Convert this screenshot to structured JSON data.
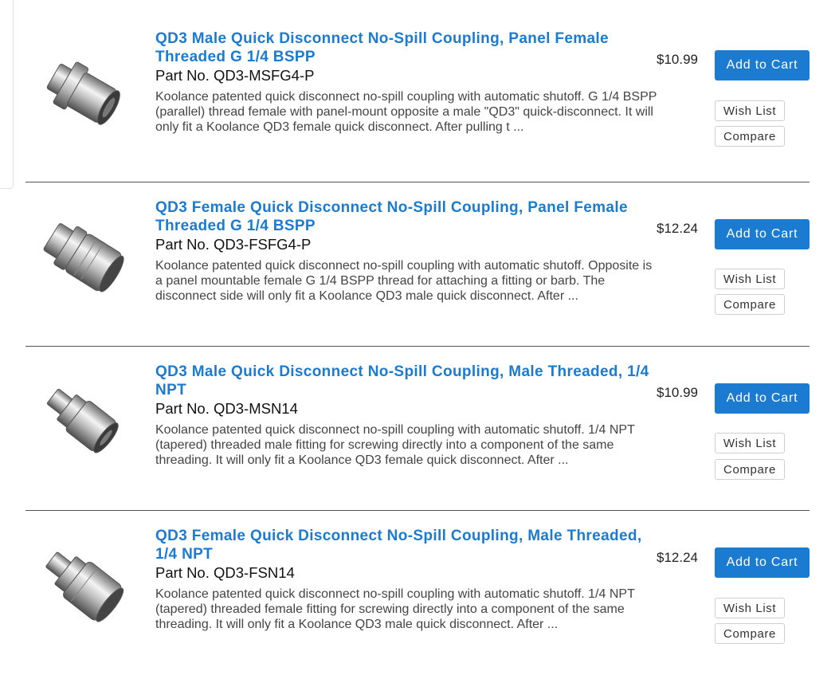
{
  "products": [
    {
      "title": "QD3 Male Quick Disconnect No-Spill Coupling, Panel Female Threaded G 1/4 BSPP",
      "part_no": "Part No. QD3-MSFG4-P",
      "description": "Koolance patented quick disconnect no-spill coupling with automatic shutoff. G 1/4 BSPP (parallel) thread female with panel-mount opposite a male \"QD3\" quick-disconnect. It will only fit a Koolance QD3 female quick disconnect. After pulling t ...",
      "price": "$10.99",
      "cart_label": "Add to Cart",
      "wish_label": "Wish List",
      "compare_label": "Compare"
    },
    {
      "title": "QD3 Female Quick Disconnect No-Spill Coupling, Panel Female Threaded G 1/4 BSPP",
      "part_no": "Part No. QD3-FSFG4-P",
      "description": "Koolance patented quick disconnect no-spill coupling with automatic shutoff. Opposite is a panel mountable female G 1/4 BSPP thread for attaching a fitting or barb. The disconnect side will only fit a Koolance QD3 male quick disconnect. After ...",
      "price": "$12.24",
      "cart_label": "Add to Cart",
      "wish_label": "Wish List",
      "compare_label": "Compare"
    },
    {
      "title": "QD3 Male Quick Disconnect No-Spill Coupling, Male Threaded, 1/4 NPT",
      "part_no": "Part No. QD3-MSN14",
      "description": "Koolance patented quick disconnect no-spill coupling with automatic shutoff. 1/4 NPT (tapered) threaded male fitting for screwing directly into a component of the same threading. It will only fit a Koolance QD3 female quick disconnect. After ...",
      "price": "$10.99",
      "cart_label": "Add to Cart",
      "wish_label": "Wish List",
      "compare_label": "Compare"
    },
    {
      "title": "QD3 Female Quick Disconnect No-Spill Coupling, Male Threaded, 1/4 NPT",
      "part_no": "Part No. QD3-FSN14",
      "description": "Koolance patented quick disconnect no-spill coupling with automatic shutoff. 1/4 NPT (tapered) threaded female fitting for screwing directly into a component of the same threading. It will only fit a Koolance QD3 male quick disconnect. After ...",
      "price": "$12.24",
      "cart_label": "Add to Cart",
      "wish_label": "Wish List",
      "compare_label": "Compare"
    }
  ],
  "colors": {
    "link": "#1a7bd0",
    "button": "#1a7bd0",
    "divider": "#555555"
  }
}
